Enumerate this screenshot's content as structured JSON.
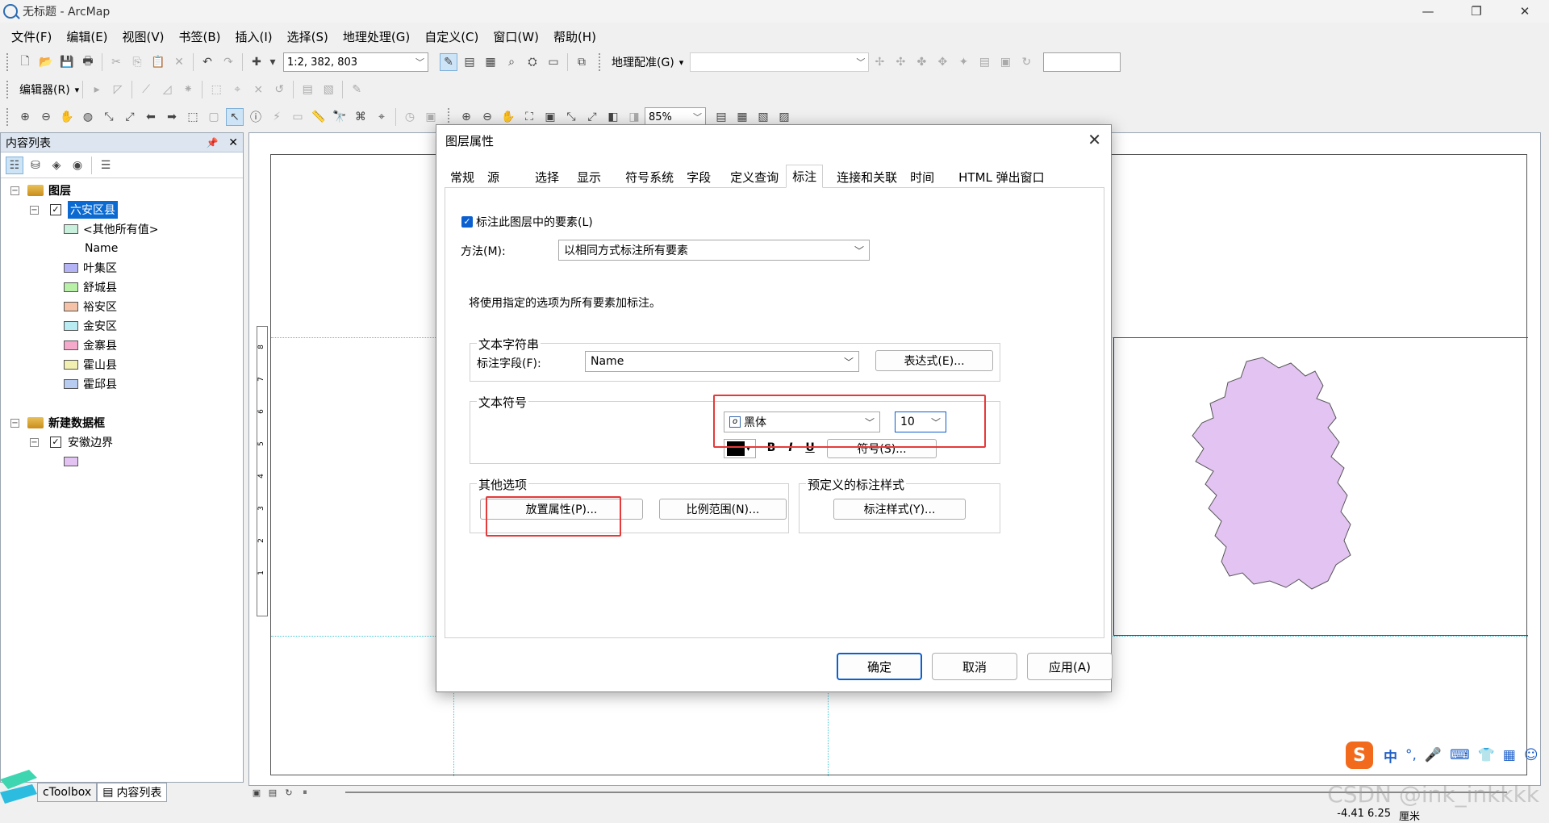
{
  "window": {
    "title": "无标题 - ArcMap",
    "minimize": "—",
    "restore": "❐",
    "close": "✕"
  },
  "menu": [
    "文件(F)",
    "编辑(E)",
    "视图(V)",
    "书签(B)",
    "插入(I)",
    "选择(S)",
    "地理处理(G)",
    "自定义(C)",
    "窗口(W)",
    "帮助(H)"
  ],
  "toolbar": {
    "scale": "1:2, 382, 803",
    "georef_label": "地理配准(G)",
    "editor_label": "编辑器(R)",
    "zoom": "85%"
  },
  "toc": {
    "title": "内容列表",
    "pin": "📌",
    "close": "✕",
    "frame1": "图层",
    "layer1": "六安区县",
    "other_values": "<其他所有值>",
    "field": "Name",
    "classes": [
      {
        "label": "叶集区",
        "color": "#b3b3f5"
      },
      {
        "label": "舒城县",
        "color": "#b8f0a8"
      },
      {
        "label": "裕安区",
        "color": "#f5c2a8"
      },
      {
        "label": "金安区",
        "color": "#b8ecf2"
      },
      {
        "label": "金寨县",
        "color": "#f5aacc"
      },
      {
        "label": "霍山县",
        "color": "#f2f0b0"
      },
      {
        "label": "霍邱县",
        "color": "#b8ccf2"
      }
    ],
    "other_color": "#c8f0dc",
    "frame2": "新建数据框",
    "layer2": "安徽边界",
    "layer2_color": "#e3c3f2",
    "tab_toolbox": "cToolbox",
    "tab_toc": "内容列表"
  },
  "dialog": {
    "title": "图层属性",
    "tabs": [
      "常规",
      "源",
      "选择",
      "显示",
      "符号系统",
      "字段",
      "定义查询",
      "标注",
      "连接和关联",
      "时间",
      "HTML 弹出窗口"
    ],
    "active_tab": "标注",
    "label_checkbox": "标注此图层中的要素(L)",
    "method_label": "方法(M):",
    "method_value": "以相同方式标注所有要素",
    "info": "将使用指定的选项为所有要素加标注。",
    "text_string_group": "文本字符串",
    "label_field_label": "标注字段(F):",
    "label_field_value": "Name",
    "expression_btn": "表达式(E)...",
    "text_symbol_group": "文本符号",
    "font": "黑体",
    "size": "10",
    "bold": "B",
    "italic": "I",
    "underline": "U",
    "symbol_btn": "符号(S)...",
    "other_group": "其他选项",
    "placement_btn": "放置属性(P)...",
    "scale_btn": "比例范围(N)...",
    "predefined_group": "预定义的标注样式",
    "label_style_btn": "标注样式(Y)...",
    "ok": "确定",
    "cancel": "取消",
    "apply": "应用(A)"
  },
  "map": {
    "polygon_color": "#e3c3f2",
    "ruler_ticks": [
      "8",
      "7",
      "6",
      "5",
      "4",
      "3",
      "2",
      "1"
    ]
  },
  "status": {
    "coords": "-4.41  6.25",
    "unit": "厘米"
  },
  "ime": {
    "logo": "S",
    "lang": "中"
  },
  "watermark": "CSDN @ink_inkkkk"
}
